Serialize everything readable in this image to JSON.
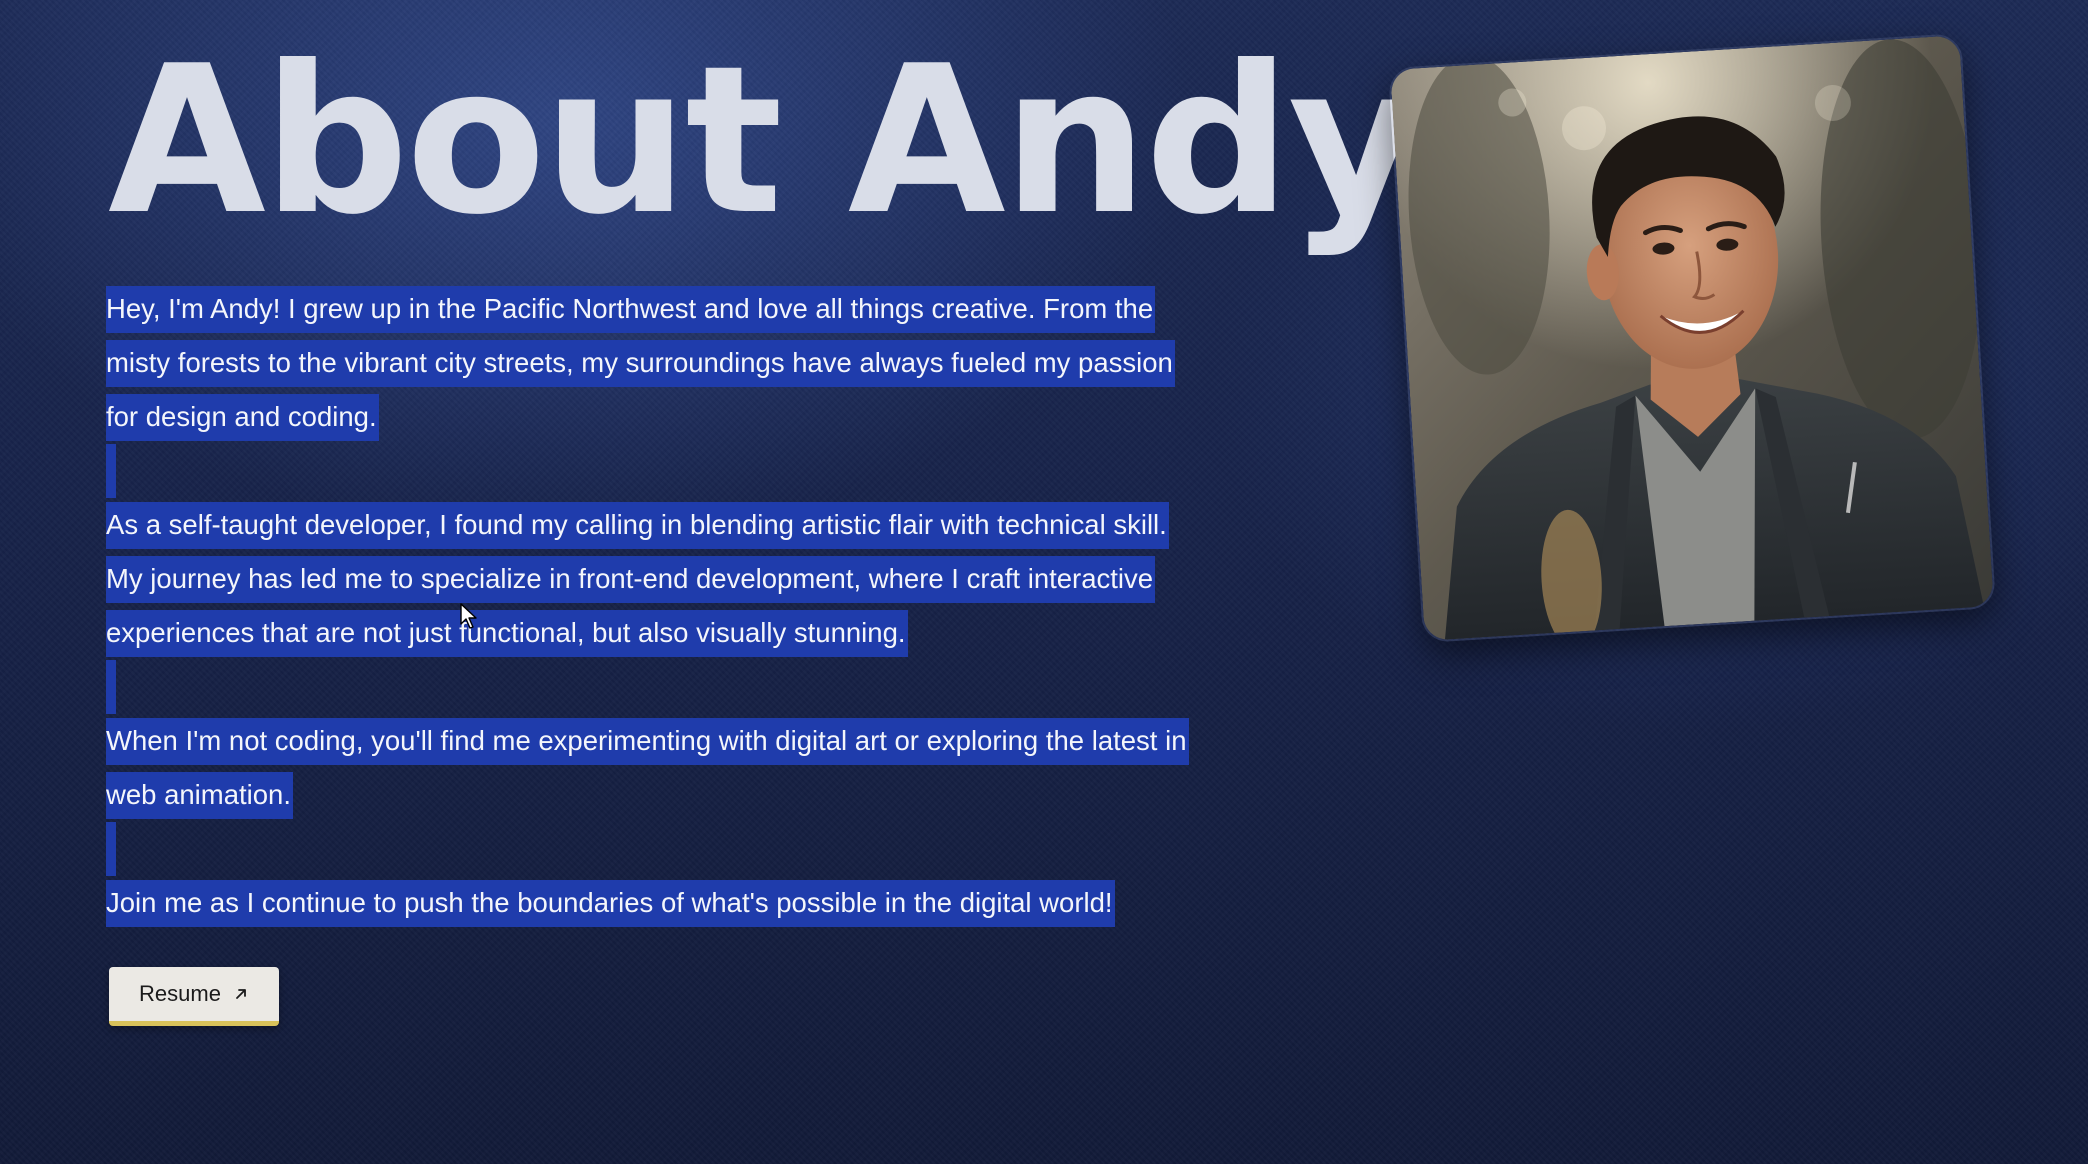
{
  "page": {
    "title": "About Andy"
  },
  "bio": {
    "paragraphs": [
      [
        "Hey, I'm Andy! I grew up in the Pacific Northwest and love all things creative. From the",
        "misty forests to the vibrant city streets, my surroundings have always fueled my passion",
        "for design and coding."
      ],
      [
        "As a self-taught developer, I found my calling in blending artistic flair with technical skill.",
        "My journey has led me to specialize in front-end development, where I craft interactive",
        "experiences that are not just functional, but also visually stunning."
      ],
      [
        "When I'm not coding, you'll find me experimenting with digital art or exploring the latest in",
        "web animation."
      ],
      [
        "Join me as I continue to push the boundaries of what's possible in the digital world!"
      ]
    ]
  },
  "resume_button": {
    "label": "Resume",
    "icon": "arrow-up-right-icon"
  },
  "photo": {
    "icon": "portrait-photo"
  },
  "colors": {
    "background": "#17234a",
    "selection_highlight": "#1f3cac",
    "title_text": "#d9dde8",
    "button_background": "#ebe9e4",
    "button_accent": "#d8c25a"
  }
}
